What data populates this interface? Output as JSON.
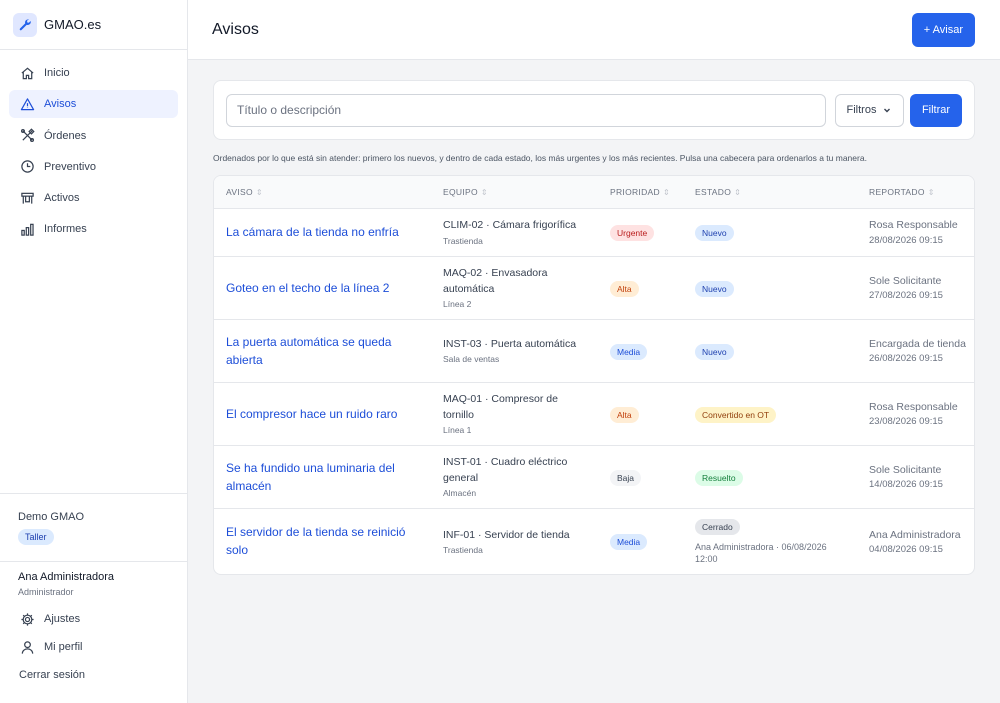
{
  "app": {
    "name": "GMAO.es"
  },
  "sidebar": {
    "items": [
      {
        "label": "Inicio",
        "icon": "home-icon"
      },
      {
        "label": "Avisos",
        "icon": "warning-icon",
        "active": true
      },
      {
        "label": "Órdenes",
        "icon": "tools-icon"
      },
      {
        "label": "Preventivo",
        "icon": "clock-icon"
      },
      {
        "label": "Activos",
        "icon": "asset-icon"
      },
      {
        "label": "Informes",
        "icon": "bar-chart-icon"
      }
    ],
    "organization": {
      "name": "Demo GMAO",
      "badge": "Taller"
    },
    "user": {
      "name": "Ana Administradora",
      "role": "Administrador"
    },
    "links": {
      "settings": "Ajustes",
      "profile": "Mi perfil",
      "logout": "Cerrar sesión"
    }
  },
  "header": {
    "title": "Avisos",
    "new_button": "+ Avisar"
  },
  "filters": {
    "search_placeholder": "Título o descripción",
    "filters_label": "Filtros",
    "submit_label": "Filtrar"
  },
  "hint": "Ordenados por lo que está sin atender: primero los nuevos, y dentro de cada estado, los más urgentes y los más recientes. Pulsa una cabecera para ordenarlos a tu manera.",
  "table": {
    "headers": {
      "aviso": "AVISO",
      "equipo": "EQUIPO",
      "prioridad": "PRIORIDAD",
      "estado": "ESTADO",
      "reportado": "REPORTADO"
    },
    "sort_glyph": "⇕",
    "rows": [
      {
        "aviso": "La cámara de la tienda no enfría",
        "equipo": "CLIM-02 · Cámara frigorífica",
        "ubicacion": "Trastienda",
        "prioridad": "Urgente",
        "estado": "Nuevo",
        "estado_nota": "",
        "reportado_por": "Rosa Responsable",
        "fecha": "28/08/2026 09:15"
      },
      {
        "aviso": "Goteo en el techo de la línea 2",
        "equipo": "MAQ-02 · Envasadora automática",
        "ubicacion": "Línea 2",
        "prioridad": "Alta",
        "estado": "Nuevo",
        "estado_nota": "",
        "reportado_por": "Sole Solicitante",
        "fecha": "27/08/2026 09:15"
      },
      {
        "aviso": "La puerta automática se queda abierta",
        "equipo": "INST-03 · Puerta automática",
        "ubicacion": "Sala de ventas",
        "prioridad": "Media",
        "estado": "Nuevo",
        "estado_nota": "",
        "reportado_por": "Encargada de tienda",
        "fecha": "26/08/2026 09:15"
      },
      {
        "aviso": "El compresor hace un ruido raro",
        "equipo": "MAQ-01 · Compresor de tornillo",
        "ubicacion": "Línea 1",
        "prioridad": "Alta",
        "estado": "Convertido en OT",
        "estado_nota": "",
        "reportado_por": "Rosa Responsable",
        "fecha": "23/08/2026 09:15"
      },
      {
        "aviso": "Se ha fundido una luminaria del almacén",
        "equipo": "INST-01 · Cuadro eléctrico general",
        "ubicacion": "Almacén",
        "prioridad": "Baja",
        "estado": "Resuelto",
        "estado_nota": "",
        "reportado_por": "Sole Solicitante",
        "fecha": "14/08/2026 09:15"
      },
      {
        "aviso": "El servidor de la tienda se reinició solo",
        "equipo": "INF-01 · Servidor de tienda",
        "ubicacion": "Trastienda",
        "prioridad": "Media",
        "estado": "Cerrado",
        "estado_nota": "Ana Administradora · 06/08/2026 12:00",
        "reportado_por": "Ana Administradora",
        "fecha": "04/08/2026 09:15"
      }
    ]
  },
  "colors": {
    "accent": "#2563eb",
    "prioridad": {
      "Urgente": {
        "bg": "#fee2e2",
        "fg": "#b91c1c"
      },
      "Alta": {
        "bg": "#ffedd5",
        "fg": "#c2410c"
      },
      "Media": {
        "bg": "#dbeafe",
        "fg": "#1d4ed8"
      },
      "Baja": {
        "bg": "#f3f4f6",
        "fg": "#374151"
      }
    },
    "estado": {
      "Nuevo": {
        "bg": "#dbeafe",
        "fg": "#1e40af"
      },
      "Convertido en OT": {
        "bg": "#fef3c7",
        "fg": "#92400e"
      },
      "Resuelto": {
        "bg": "#dcfce7",
        "fg": "#15803d"
      },
      "Cerrado": {
        "bg": "#e5e7eb",
        "fg": "#374151"
      }
    }
  }
}
